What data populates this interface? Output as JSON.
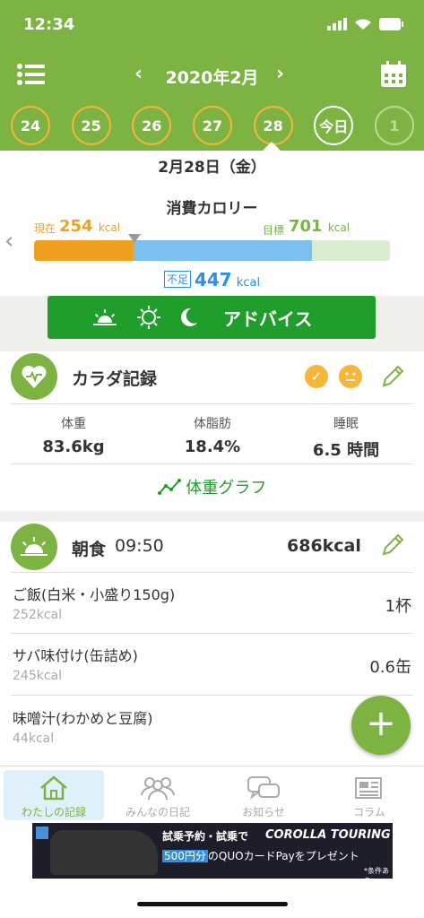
{
  "status": {
    "time": "12:34"
  },
  "header": {
    "month": "2020年2月",
    "prev": "‹",
    "next": "›"
  },
  "days": [
    "24",
    "25",
    "26",
    "27",
    "28",
    "今日",
    "1"
  ],
  "date_label": "2月28日（金）",
  "calorie": {
    "title": "消費カロリー",
    "current_label": "現在",
    "current_value": "254",
    "goal_label": "目標",
    "goal_value": "701",
    "unit": "kcal",
    "lack_label": "不足",
    "lack_value": "447",
    "current_fraction": 0.28,
    "lack_fraction": 0.5
  },
  "advice": {
    "label": "アドバイス"
  },
  "body_record": {
    "title": "カラダ記録",
    "stats": [
      {
        "key": "体重",
        "value": "83.6kg"
      },
      {
        "key": "体脂肪",
        "value": "18.4%"
      },
      {
        "key": "睡眠",
        "value": "6.5 時間"
      }
    ],
    "graph_link": "体重グラフ"
  },
  "breakfast": {
    "title": "朝食",
    "time": "09:50",
    "kcal": "686kcal",
    "items": [
      {
        "name": "ご飯(白米・小盛り150g)",
        "kcal": "252kcal",
        "qty": "1杯"
      },
      {
        "name": "サバ味付け(缶詰め)",
        "kcal": "245kcal",
        "qty": "0.6缶"
      },
      {
        "name": "味噌汁(わかめと豆腐)",
        "kcal": "44kcal",
        "qty": ""
      }
    ]
  },
  "tabs": [
    "わたしの記録",
    "みんなの日記",
    "お知らせ",
    "コラム"
  ],
  "ad": {
    "line1": "試乗予約・試乗で",
    "brand": "COROLLA TOURING",
    "line2a": "500円分",
    "line2b": "のQUOカードPayをプレゼント",
    "note": "*条件あり"
  },
  "colors": {
    "green": "#7cb342",
    "orange": "#f0a020",
    "blue": "#2f8fe0",
    "advice": "#1f9e2c"
  }
}
